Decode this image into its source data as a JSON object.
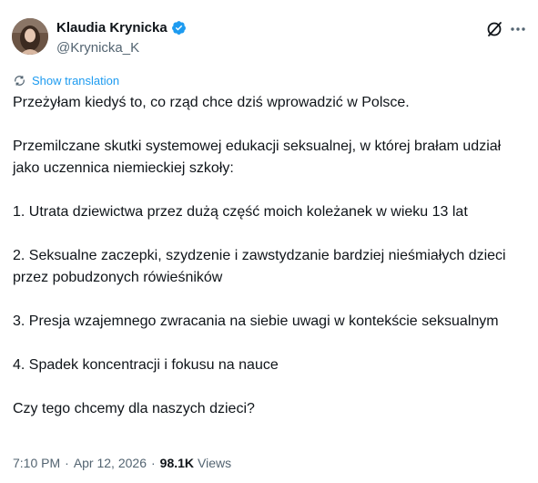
{
  "author": {
    "display_name": "Klaudia Krynicka",
    "handle": "@Krynicka_K",
    "verified": true,
    "verified_color": "#1d9bf0"
  },
  "actions": {
    "grok_icon": "grok-icon",
    "more_icon": "more-icon"
  },
  "translation": {
    "label": "Show translation",
    "color": "#1d9bf0"
  },
  "tweet": {
    "paragraphs": [
      "Przeżyłam kiedyś to, co rząd chce dziś wprowadzić w Polsce.",
      "Przemilczane skutki systemowej edukacji seksualnej, w której brałam udział jako uczennica niemieckiej szkoły:",
      "1. Utrata dziewictwa przez dużą część moich koleżanek w wieku 13 lat",
      "2. Seksualne zaczepki, szydzenie i zawstydzanie bardziej nieśmiałych dzieci przez pobudzonych rówieśników",
      "3. Presja wzajemnego zwracania na siebie uwagi w kontekście seksualnym",
      "4. Spadek koncentracji i fokusu na nauce",
      "Czy tego chcemy dla naszych dzieci?"
    ]
  },
  "meta": {
    "time": "7:10 PM",
    "separator": "·",
    "date": "Apr 12, 2026",
    "views_count": "98.1K",
    "views_label": "Views"
  }
}
